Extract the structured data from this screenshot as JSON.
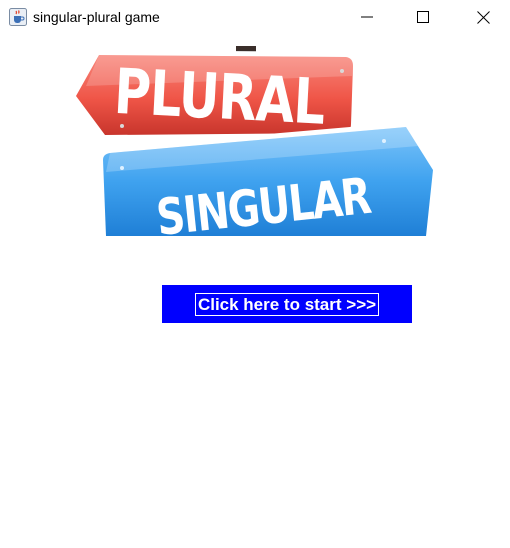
{
  "window": {
    "title": "singular-plural game",
    "icon": "java-coffee-cup-icon"
  },
  "title_controls": {
    "minimize_icon": "minimize-icon",
    "maximize_icon": "maximize-icon",
    "close_icon": "close-icon"
  },
  "banner": {
    "top_sign": "PLURAL",
    "bottom_sign": "SINGULAR",
    "top_sign_color": "#f0574c",
    "bottom_sign_color": "#3fa2ef"
  },
  "start": {
    "label": "Click here to start >>>",
    "background": "#0000ff",
    "text_color": "#ffffff"
  }
}
